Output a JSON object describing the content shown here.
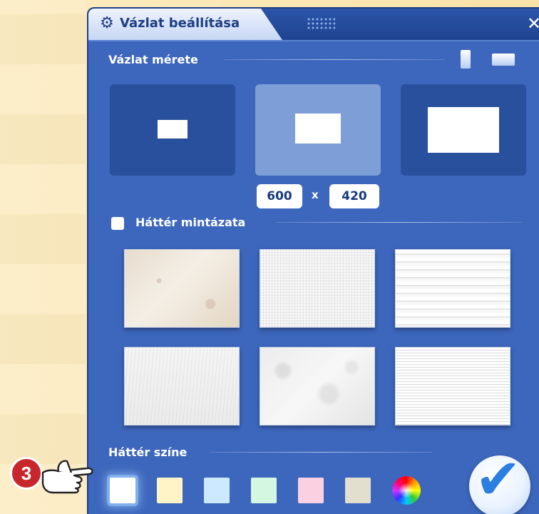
{
  "dialog": {
    "title": "Vázlat beállítása",
    "icons": {
      "settings": "gear-icon",
      "drag": "grip-icon",
      "close": "close-icon"
    }
  },
  "size_section": {
    "label": "Vázlat mérete",
    "orientation_icons": [
      "portrait-icon",
      "landscape-icon"
    ],
    "options": [
      "small",
      "medium",
      "large"
    ],
    "selected_option": "medium",
    "width_value": "600",
    "separator": "x",
    "height_value": "420"
  },
  "pattern_section": {
    "label": "Háttér mintázata",
    "checked": false,
    "patterns": [
      "old-paper",
      "canvas",
      "stripes",
      "fiber",
      "crumpled",
      "lines"
    ]
  },
  "color_section": {
    "label": "Háttér színe",
    "swatches": [
      "#ffffff",
      "#fff4c8",
      "#cde9ff",
      "#d4f7e1",
      "#fbd0e0",
      "#e3dfcf"
    ],
    "selected_swatch": "#ffffff",
    "custom_color_icon": "color-wheel-icon"
  },
  "ok_icon": "check-icon",
  "step_badge": "3",
  "colors": {
    "dialog_bg": "#3d67bd",
    "titlebar": "#1f4390",
    "accent_check": "#2b7fe0",
    "badge": "#c7262c"
  }
}
